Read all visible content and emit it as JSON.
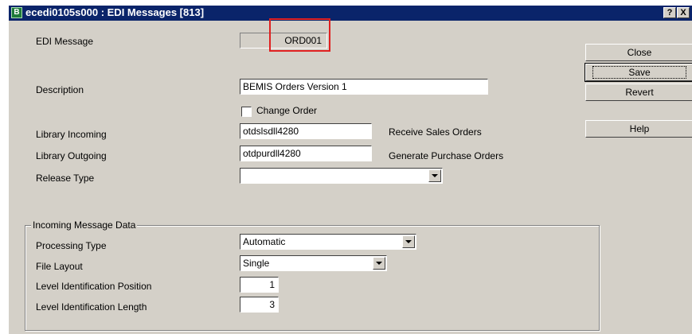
{
  "window": {
    "title": "ecedi0105s000 : EDI Messages [813]",
    "help_button": "?",
    "close_button": "X"
  },
  "fields": {
    "edi_message": {
      "label": "EDI Message",
      "value": "ORD001"
    },
    "description": {
      "label": "Description",
      "value": "BEMIS Orders Version 1"
    },
    "change_order": {
      "label": "Change Order",
      "checked": false
    },
    "library_incoming": {
      "label": "Library Incoming",
      "value": "otdslsdll4280",
      "desc": "Receive Sales Orders"
    },
    "library_outgoing": {
      "label": "Library Outgoing",
      "value": "otdpurdll4280",
      "desc": "Generate Purchase Orders"
    },
    "release_type": {
      "label": "Release Type",
      "value": ""
    }
  },
  "incoming_group": {
    "title": "Incoming Message Data",
    "processing_type": {
      "label": "Processing Type",
      "value": "Automatic"
    },
    "file_layout": {
      "label": "File Layout",
      "value": "Single"
    },
    "level_id_position": {
      "label": "Level Identification Position",
      "value": "1"
    },
    "level_id_length": {
      "label": "Level Identification Length",
      "value": "3"
    }
  },
  "buttons": {
    "close": "Close",
    "save": "Save",
    "revert": "Revert",
    "help": "Help"
  },
  "colors": {
    "titlebar": "#0a246a",
    "face": "#d4d0c8",
    "highlight_box": "#e02020"
  }
}
